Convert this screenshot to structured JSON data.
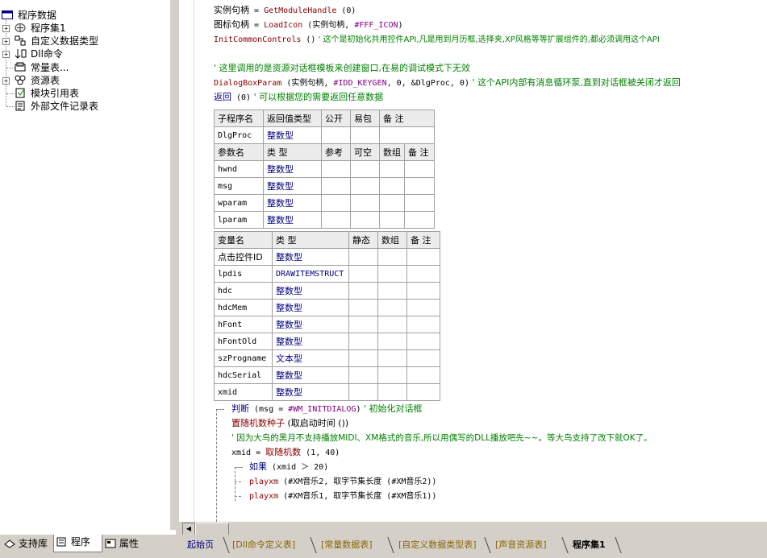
{
  "tree": {
    "root": "程序数据",
    "items": [
      {
        "label": "程序集1",
        "icon": "program-set-icon",
        "expander": "+"
      },
      {
        "label": "自定义数据类型",
        "icon": "data-type-icon",
        "expander": "+"
      },
      {
        "label": "Dll命令",
        "icon": "dll-icon",
        "expander": "+"
      },
      {
        "label": "常量表...",
        "icon": "constant-icon",
        "expander": ""
      },
      {
        "label": "资源表",
        "icon": "resource-icon",
        "expander": "+"
      },
      {
        "label": "模块引用表",
        "icon": "module-ref-icon",
        "expander": ""
      },
      {
        "label": "外部文件记录表",
        "icon": "external-file-icon",
        "expander": ""
      }
    ]
  },
  "left_tabs": [
    {
      "label": "支持库",
      "icon": "library-icon"
    },
    {
      "label": "程序",
      "icon": "program-icon",
      "active": true
    },
    {
      "label": "属性",
      "icon": "property-icon"
    }
  ],
  "code": {
    "line1": {
      "var": "实例句柄",
      "eq": " = ",
      "fn": "GetModuleHandle",
      "args": " (0)"
    },
    "line2": {
      "var": "图标句柄",
      "eq": " = ",
      "fn": "LoadIcon",
      "args_a": " (实例句柄, ",
      "const": "#FFF_ICON",
      "args_b": ")"
    },
    "line3": {
      "fn": "InitCommonControls",
      "args": " ()",
      "comment": "  ' 这个是初始化共用控件API,凡是用到月历框,选择夹,XP风格等等扩展组件的,都必须调用这个API"
    },
    "line4": {
      "comment": "' 这里调用的是资源对话框模板来创建窗口,在易的调试模式下无效"
    },
    "line5": {
      "fn": "DialogBoxParam",
      "args_a": " (实例句柄, ",
      "const": "#IDD_KEYGEN",
      "args_b": ", 0, &DlgProc, 0)",
      "comment": "  ' 这个API内部有消息循环泵,直到对话框被关闭才返回"
    },
    "line6": {
      "kw": "返回",
      "args": " (0)",
      "comment": "  ' 可以根据您的需要返回任意数据"
    }
  },
  "sub_table": {
    "headers": [
      "子程序名",
      "返回值类型",
      "公开",
      "易包",
      "备 注"
    ],
    "name": "DlgProc",
    "return_type": "整数型",
    "param_headers": [
      "参数名",
      "类 型",
      "参考",
      "可空",
      "数组",
      "备 注"
    ],
    "params": [
      {
        "name": "hwnd",
        "type": "整数型"
      },
      {
        "name": "msg",
        "type": "整数型"
      },
      {
        "name": "wparam",
        "type": "整数型"
      },
      {
        "name": "lparam",
        "type": "整数型"
      }
    ]
  },
  "var_table": {
    "headers": [
      "变量名",
      "类 型",
      "静态",
      "数组",
      "备 注"
    ],
    "vars": [
      {
        "name": "点击控件ID",
        "type": "整数型"
      },
      {
        "name": "lpdis",
        "type": "DRAWITEMSTRUCT"
      },
      {
        "name": "hdc",
        "type": "整数型"
      },
      {
        "name": "hdcMem",
        "type": "整数型"
      },
      {
        "name": "hFont",
        "type": "整数型"
      },
      {
        "name": "hFontOld",
        "type": "整数型"
      },
      {
        "name": "szProgname",
        "type": "文本型"
      },
      {
        "name": "hdcSerial",
        "type": "整数型"
      },
      {
        "name": "xmid",
        "type": "整数型"
      }
    ]
  },
  "body": {
    "b1": {
      "kw": "判断",
      "args_a": " (msg = ",
      "const": "#WM_INITDIALOG",
      "args_b": ")",
      "comment": "  ' 初始化对话框"
    },
    "b2": {
      "fn": "置随机数种子",
      "args": " (取启动时间 ())"
    },
    "b3": {
      "comment": "' 因为大鸟的黑月不支持播放MIDI、XM格式的音乐,所以用偶写的DLL播放吧先~~。等大鸟支持了改下就OK了。"
    },
    "b4": {
      "text_a": "xmid = ",
      "fn": "取随机数",
      "args": " (1, 40)"
    },
    "b5": {
      "kw": "如果",
      "args": " (xmid ＞ 20)"
    },
    "b6": {
      "fn": "playxm",
      "args": " (#XM音乐2, 取字节集长度 (#XM音乐2))"
    },
    "b7": {
      "fn": "playxm",
      "args": " (#XM音乐1, 取字节集长度 (#XM音乐1))"
    }
  },
  "doc_tabs": [
    {
      "label": "起始页",
      "first": true
    },
    {
      "label": "[Dll命令定义表]"
    },
    {
      "label": "[常量数据表]"
    },
    {
      "label": "[自定义数据类型表]"
    },
    {
      "label": "[声音资源表]"
    },
    {
      "label": "程序集1",
      "active": true
    }
  ]
}
